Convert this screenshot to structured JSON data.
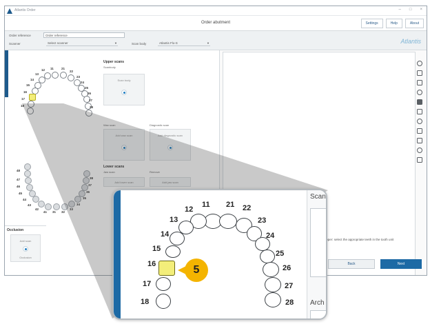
{
  "window": {
    "app_title": "Atlantis Order",
    "page_title": "Order abutment",
    "top_links": [
      "Settings",
      "Help",
      "About"
    ],
    "controls": [
      "–",
      "□",
      "×"
    ]
  },
  "form": {
    "order_ref_label": "Order reference",
    "order_ref_value": "Order reference",
    "scanner_label": "Scanner",
    "scanner_value": "Select scanner",
    "scan_body_label": "Scan body",
    "scan_body_value": "Atlantis Flo-S",
    "brand": "Atlantis"
  },
  "left_panel": {
    "upper_jaw_numbers": [
      "11",
      "21",
      "22",
      "23",
      "24",
      "25",
      "26",
      "27",
      "28",
      "12",
      "13",
      "14",
      "15",
      "16",
      "17",
      "18"
    ],
    "lower_jaw_numbers": [
      "31",
      "32",
      "33",
      "34",
      "35",
      "36",
      "37",
      "38",
      "41",
      "42",
      "43",
      "44",
      "45",
      "46",
      "47",
      "48"
    ],
    "upper_scans_title": "Upper scans",
    "upper_scans_sub": "Scanbody",
    "box_scan_body": "Scan body",
    "box_wax_scan": "Wax scan",
    "box_diagnostic_scan": "Diagnostic scan",
    "add_wax_scan": "Add wax scan",
    "add_diagnostic_scan": "Add diagnostic scan",
    "lower_scans_title": "Lower scans",
    "lower_scans_sub": "Jaw scan",
    "add_lower_scan": "Add lower scan",
    "remove": "Remove",
    "add_jaw_scan": "Add jaw scan"
  },
  "occlusion": {
    "title": "Occlusion",
    "box_label": "Add scan",
    "sub_label": "Occlusion"
  },
  "viewer": {
    "hint": "Upper: select the appropriate teeth in the tooth unit",
    "back": "Back",
    "next": "Next",
    "tools": [
      "pan-icon",
      "zoom-icon",
      "rotate-icon",
      "reset-view-icon",
      "solid-icon",
      "front-view-icon",
      "back-view-icon",
      "left-view-icon",
      "right-view-icon",
      "top-view-icon",
      "bottom-view-icon"
    ]
  },
  "magnifier": {
    "tooth_numbers": [
      "11",
      "21",
      "22",
      "23",
      "24",
      "25",
      "26",
      "27",
      "28",
      "12",
      "13",
      "14",
      "15",
      "16",
      "17",
      "18"
    ],
    "selected_tooth": "16",
    "callout_number": "5",
    "right_label_top": "Scan",
    "right_label_bottom": "Arch"
  },
  "colors": {
    "accent": "#1d6aa5",
    "selected_tooth": "#f3ee7a",
    "callout": "#f4b400"
  }
}
